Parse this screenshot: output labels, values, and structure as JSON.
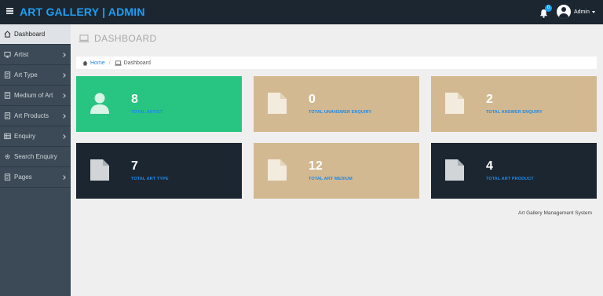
{
  "header": {
    "brand": "ART GALLERY | ADMIN",
    "notification_count": "0",
    "user_name": "Admin"
  },
  "sidebar": {
    "items": [
      {
        "label": "Dashboard",
        "icon": "home-icon"
      },
      {
        "label": "Artist",
        "icon": "monitor-icon"
      },
      {
        "label": "Art Type",
        "icon": "file-icon"
      },
      {
        "label": "Medium of Art",
        "icon": "file-icon"
      },
      {
        "label": "Art Products",
        "icon": "file-icon"
      },
      {
        "label": "Enquiry",
        "icon": "table-icon"
      },
      {
        "label": "Search Enquiry",
        "icon": "gear-icon"
      },
      {
        "label": "Pages",
        "icon": "file-icon"
      }
    ]
  },
  "page": {
    "title": "DASHBOARD"
  },
  "breadcrumb": {
    "home": "Home",
    "current": "Dashboard"
  },
  "cards": [
    {
      "value": "8",
      "label": "TOTAL ARTIST",
      "color": "#28c481"
    },
    {
      "value": "0",
      "label": "TOTAL UNANSWER ENQUIRY",
      "color": "#d3b992"
    },
    {
      "value": "2",
      "label": "TOTAL ANSWER ENQUIRY",
      "color": "#d3b992"
    },
    {
      "value": "7",
      "label": "TOTAL ART TYPE",
      "color": "#1c2631"
    },
    {
      "value": "12",
      "label": "TOTAL ART MEDIUM",
      "color": "#d3b992"
    },
    {
      "value": "4",
      "label": "TOTAL ART PRODUCT",
      "color": "#1c2631"
    }
  ],
  "footer": {
    "text": "Art Gallery Management System"
  },
  "colors": {
    "accent": "#1e9ff2",
    "topbar": "#1c2631",
    "sidebar": "#3b4a56"
  }
}
